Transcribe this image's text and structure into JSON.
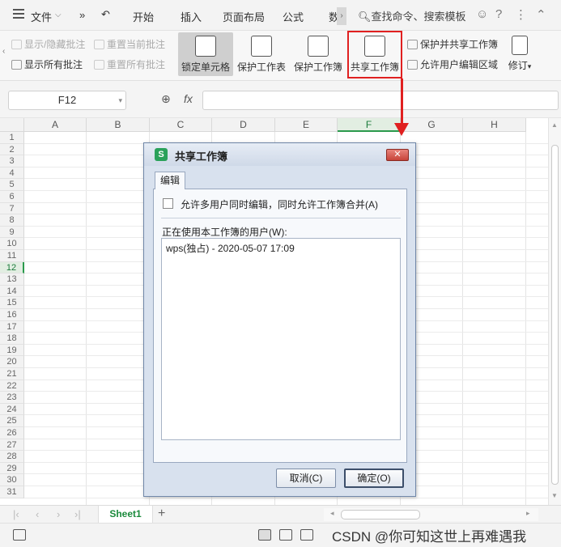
{
  "menubar": {
    "items": [
      "文件",
      "»",
      "开始",
      "插入",
      "页面布局",
      "公式",
      "数"
    ],
    "search": "查找命令、搜索模板",
    "icons": [
      "menu-icon",
      "chevron-down-icon",
      "smiley-icon",
      "help-icon",
      "more-icon",
      "collapse-icon"
    ]
  },
  "ribbon": {
    "small_left": [
      {
        "label": "显示/隐藏批注",
        "disabled": true
      },
      {
        "label": "显示所有批注",
        "disabled": false
      },
      {
        "label": "重置当前批注",
        "disabled": true
      },
      {
        "label": "重置所有批注",
        "disabled": true
      }
    ],
    "big": [
      {
        "label": "锁定单元格",
        "selected": true
      },
      {
        "label": "保护工作表"
      },
      {
        "label": "保护工作簿"
      },
      {
        "label": "共享工作簿"
      }
    ],
    "small_right": [
      {
        "label": "保护并共享工作簿"
      },
      {
        "label": "允许用户编辑区域"
      }
    ],
    "revise": "修订"
  },
  "formula": {
    "cell_ref": "F12",
    "fx": "fx"
  },
  "grid": {
    "columns": [
      "A",
      "B",
      "C",
      "D",
      "E",
      "F",
      "G",
      "H"
    ],
    "active_column": "F",
    "active_row": 12,
    "rows": 31
  },
  "sheets": {
    "tabs": [
      "Sheet1"
    ],
    "add": "+"
  },
  "statusbar": {
    "watermark": "CSDN @你可知这世上再难遇我"
  },
  "dialog": {
    "title": "共享工作簿",
    "logo": "S",
    "close": "✕",
    "tab": "编辑",
    "checkbox_label": "允许多用户同时编辑，同时允许工作簿合并(A)",
    "checkbox_checked": false,
    "users_label": "正在使用本工作簿的用户(W):",
    "users": [
      "wps(独占) - 2020-05-07 17:09"
    ],
    "cancel": "取消(C)",
    "ok": "确定(O)"
  },
  "colors": {
    "accent_green": "#2b9a4d",
    "highlight_red": "#e02020",
    "dialog_bg": "#d8e1ee"
  }
}
